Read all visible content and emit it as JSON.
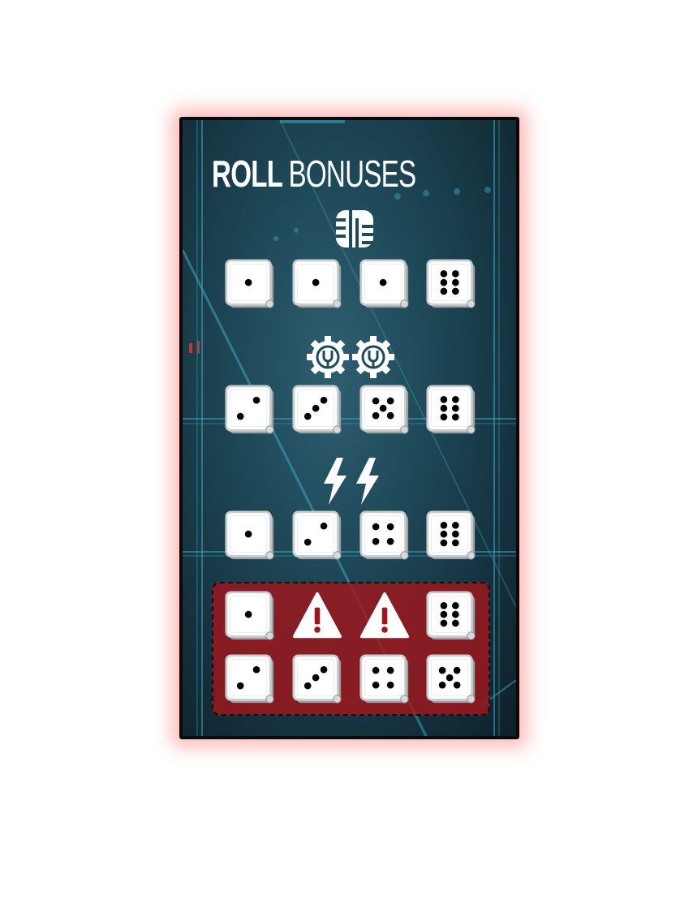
{
  "card": {
    "title_bold": "ROLL",
    "title_light": "BONUSES",
    "glow_color": "#ff4040",
    "danger_color": "#a0161c"
  },
  "sections": [
    {
      "icon": "data-chip-icon",
      "dice": [
        1,
        1,
        1,
        6
      ]
    },
    {
      "icon": "gear-wrench-icon",
      "icon_count": 2,
      "dice": [
        2,
        3,
        5,
        6
      ]
    },
    {
      "icon": "lightning-icon",
      "icon_count": 2,
      "dice": [
        1,
        2,
        4,
        6
      ]
    }
  ],
  "danger_zone": {
    "row1": [
      1,
      "warning",
      "warning",
      6
    ],
    "row2": [
      2,
      3,
      4,
      5
    ]
  }
}
